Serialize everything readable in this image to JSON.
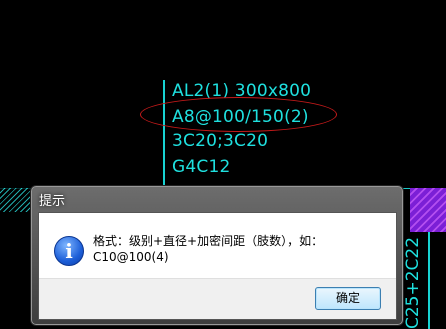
{
  "cad": {
    "annotation_lines": [
      "AL2(1) 300x800",
      "A8@100/150(2)",
      "3C20;3C20",
      "G4C12"
    ],
    "side_text": "C25+2C22",
    "colors": {
      "annotation": "#1fe0df",
      "highlight_ellipse": "#c41a1a",
      "hatch": "#7b1fd6"
    }
  },
  "dialog": {
    "title": "提示",
    "icon": "info-icon",
    "message_line1": "格式：级别+直径+加密间距（肢数），如：",
    "message_line2": "C10@100(4)",
    "ok_label": "确定"
  }
}
